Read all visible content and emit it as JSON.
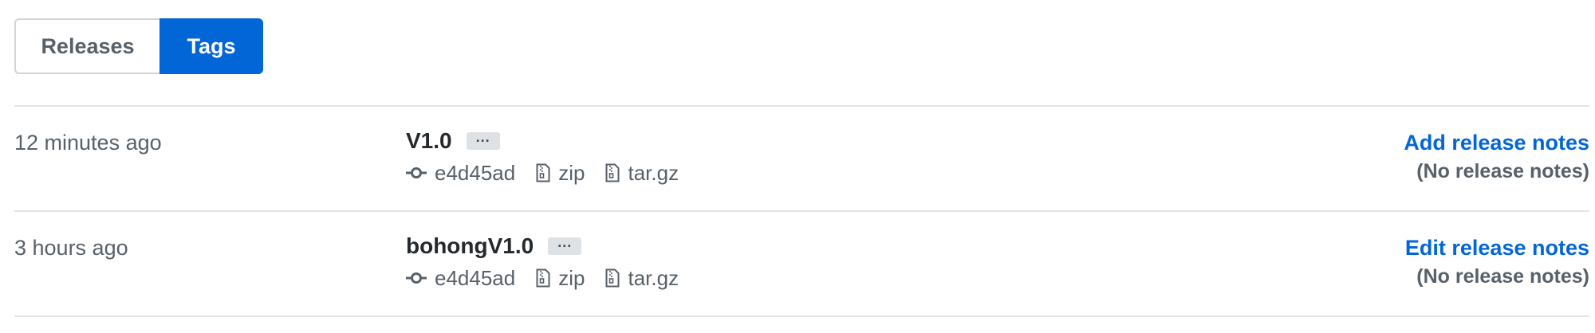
{
  "tabs": {
    "releases": "Releases",
    "tags": "Tags"
  },
  "active_tab": "Tags",
  "colors": {
    "accent": "#0366d6",
    "muted_text": "#586069",
    "border": "#e1e4e8"
  },
  "tags": [
    {
      "time": "12 minutes ago",
      "name": "V1.0",
      "ellipsis": "···",
      "commit": "e4d45ad",
      "zip": "zip",
      "targz": "tar.gz",
      "action": "Add release notes",
      "note": "(No release notes)"
    },
    {
      "time": "3 hours ago",
      "name": "bohongV1.0",
      "ellipsis": "···",
      "commit": "e4d45ad",
      "zip": "zip",
      "targz": "tar.gz",
      "action": "Edit release notes",
      "note": "(No release notes)"
    }
  ],
  "icons": {
    "commit": "git-commit-icon",
    "zip": "file-zip-icon",
    "targz": "file-zip-icon"
  }
}
